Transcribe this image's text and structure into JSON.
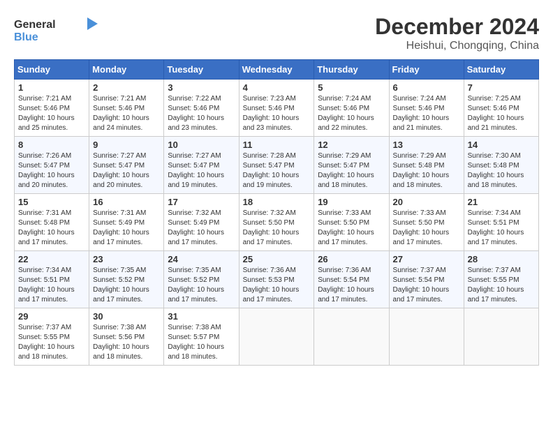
{
  "logo": {
    "general": "General",
    "blue": "Blue"
  },
  "title": "December 2024",
  "subtitle": "Heishui, Chongqing, China",
  "weekdays": [
    "Sunday",
    "Monday",
    "Tuesday",
    "Wednesday",
    "Thursday",
    "Friday",
    "Saturday"
  ],
  "weeks": [
    [
      {
        "day": "1",
        "sunrise": "7:21 AM",
        "sunset": "5:46 PM",
        "daylight": "10 hours and 25 minutes."
      },
      {
        "day": "2",
        "sunrise": "7:21 AM",
        "sunset": "5:46 PM",
        "daylight": "10 hours and 24 minutes."
      },
      {
        "day": "3",
        "sunrise": "7:22 AM",
        "sunset": "5:46 PM",
        "daylight": "10 hours and 23 minutes."
      },
      {
        "day": "4",
        "sunrise": "7:23 AM",
        "sunset": "5:46 PM",
        "daylight": "10 hours and 23 minutes."
      },
      {
        "day": "5",
        "sunrise": "7:24 AM",
        "sunset": "5:46 PM",
        "daylight": "10 hours and 22 minutes."
      },
      {
        "day": "6",
        "sunrise": "7:24 AM",
        "sunset": "5:46 PM",
        "daylight": "10 hours and 21 minutes."
      },
      {
        "day": "7",
        "sunrise": "7:25 AM",
        "sunset": "5:46 PM",
        "daylight": "10 hours and 21 minutes."
      }
    ],
    [
      {
        "day": "8",
        "sunrise": "7:26 AM",
        "sunset": "5:47 PM",
        "daylight": "10 hours and 20 minutes."
      },
      {
        "day": "9",
        "sunrise": "7:27 AM",
        "sunset": "5:47 PM",
        "daylight": "10 hours and 20 minutes."
      },
      {
        "day": "10",
        "sunrise": "7:27 AM",
        "sunset": "5:47 PM",
        "daylight": "10 hours and 19 minutes."
      },
      {
        "day": "11",
        "sunrise": "7:28 AM",
        "sunset": "5:47 PM",
        "daylight": "10 hours and 19 minutes."
      },
      {
        "day": "12",
        "sunrise": "7:29 AM",
        "sunset": "5:47 PM",
        "daylight": "10 hours and 18 minutes."
      },
      {
        "day": "13",
        "sunrise": "7:29 AM",
        "sunset": "5:48 PM",
        "daylight": "10 hours and 18 minutes."
      },
      {
        "day": "14",
        "sunrise": "7:30 AM",
        "sunset": "5:48 PM",
        "daylight": "10 hours and 18 minutes."
      }
    ],
    [
      {
        "day": "15",
        "sunrise": "7:31 AM",
        "sunset": "5:48 PM",
        "daylight": "10 hours and 17 minutes."
      },
      {
        "day": "16",
        "sunrise": "7:31 AM",
        "sunset": "5:49 PM",
        "daylight": "10 hours and 17 minutes."
      },
      {
        "day": "17",
        "sunrise": "7:32 AM",
        "sunset": "5:49 PM",
        "daylight": "10 hours and 17 minutes."
      },
      {
        "day": "18",
        "sunrise": "7:32 AM",
        "sunset": "5:50 PM",
        "daylight": "10 hours and 17 minutes."
      },
      {
        "day": "19",
        "sunrise": "7:33 AM",
        "sunset": "5:50 PM",
        "daylight": "10 hours and 17 minutes."
      },
      {
        "day": "20",
        "sunrise": "7:33 AM",
        "sunset": "5:50 PM",
        "daylight": "10 hours and 17 minutes."
      },
      {
        "day": "21",
        "sunrise": "7:34 AM",
        "sunset": "5:51 PM",
        "daylight": "10 hours and 17 minutes."
      }
    ],
    [
      {
        "day": "22",
        "sunrise": "7:34 AM",
        "sunset": "5:51 PM",
        "daylight": "10 hours and 17 minutes."
      },
      {
        "day": "23",
        "sunrise": "7:35 AM",
        "sunset": "5:52 PM",
        "daylight": "10 hours and 17 minutes."
      },
      {
        "day": "24",
        "sunrise": "7:35 AM",
        "sunset": "5:52 PM",
        "daylight": "10 hours and 17 minutes."
      },
      {
        "day": "25",
        "sunrise": "7:36 AM",
        "sunset": "5:53 PM",
        "daylight": "10 hours and 17 minutes."
      },
      {
        "day": "26",
        "sunrise": "7:36 AM",
        "sunset": "5:54 PM",
        "daylight": "10 hours and 17 minutes."
      },
      {
        "day": "27",
        "sunrise": "7:37 AM",
        "sunset": "5:54 PM",
        "daylight": "10 hours and 17 minutes."
      },
      {
        "day": "28",
        "sunrise": "7:37 AM",
        "sunset": "5:55 PM",
        "daylight": "10 hours and 17 minutes."
      }
    ],
    [
      {
        "day": "29",
        "sunrise": "7:37 AM",
        "sunset": "5:55 PM",
        "daylight": "10 hours and 18 minutes."
      },
      {
        "day": "30",
        "sunrise": "7:38 AM",
        "sunset": "5:56 PM",
        "daylight": "10 hours and 18 minutes."
      },
      {
        "day": "31",
        "sunrise": "7:38 AM",
        "sunset": "5:57 PM",
        "daylight": "10 hours and 18 minutes."
      },
      null,
      null,
      null,
      null
    ]
  ]
}
